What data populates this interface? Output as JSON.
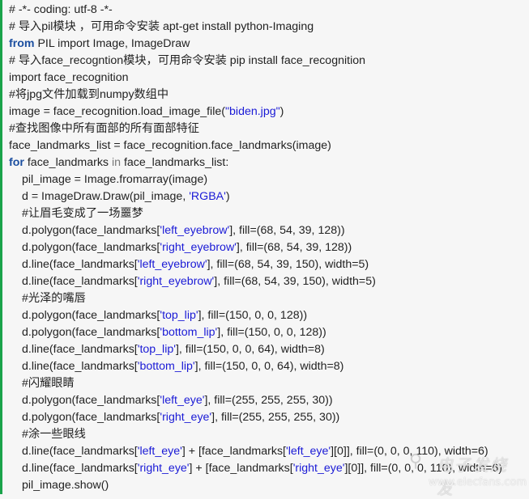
{
  "code": {
    "language": "python",
    "accent_border": "#1aa34a",
    "keyword_color": "#1c4fa0",
    "string_color": "#1a1ad6",
    "lines": [
      {
        "indent": 0,
        "parts": [
          {
            "t": "text",
            "v": "# -*- coding: utf-8 -*-"
          }
        ]
      },
      {
        "indent": 0,
        "parts": [
          {
            "t": "text",
            "v": "# 导入pil模块 ，可用命令安装 apt-get install python-Imaging"
          }
        ]
      },
      {
        "indent": 0,
        "parts": [
          {
            "t": "kw",
            "v": "from"
          },
          {
            "t": "text",
            "v": " PIL import Image, ImageDraw"
          }
        ]
      },
      {
        "indent": 0,
        "parts": [
          {
            "t": "text",
            "v": "# 导入face_recogntion模块，可用命令安装 pip install face_recognition"
          }
        ]
      },
      {
        "indent": 0,
        "parts": [
          {
            "t": "text",
            "v": "import face_recognition"
          }
        ]
      },
      {
        "indent": 0,
        "parts": [
          {
            "t": "text",
            "v": "#将jpg文件加载到numpy数组中"
          }
        ]
      },
      {
        "indent": 0,
        "parts": [
          {
            "t": "text",
            "v": "image = face_recognition.load_image_file("
          },
          {
            "t": "str",
            "v": "\"biden.jpg\""
          },
          {
            "t": "text",
            "v": ")"
          }
        ]
      },
      {
        "indent": 0,
        "parts": [
          {
            "t": "text",
            "v": "#查找图像中所有面部的所有面部特征"
          }
        ]
      },
      {
        "indent": 0,
        "parts": [
          {
            "t": "text",
            "v": "face_landmarks_list = face_recognition.face_landmarks(image)"
          }
        ]
      },
      {
        "indent": 0,
        "parts": [
          {
            "t": "kw",
            "v": "for"
          },
          {
            "t": "text",
            "v": " face_landmarks "
          },
          {
            "t": "kwin",
            "v": "in"
          },
          {
            "t": "text",
            "v": " face_landmarks_list:"
          }
        ]
      },
      {
        "indent": 1,
        "parts": [
          {
            "t": "text",
            "v": "pil_image = Image.fromarray(image)"
          }
        ]
      },
      {
        "indent": 1,
        "parts": [
          {
            "t": "text",
            "v": "d = ImageDraw.Draw(pil_image, "
          },
          {
            "t": "str",
            "v": "'RGBA'"
          },
          {
            "t": "text",
            "v": ")"
          }
        ]
      },
      {
        "indent": 1,
        "parts": [
          {
            "t": "text",
            "v": "#让眉毛变成了一场噩梦"
          }
        ]
      },
      {
        "indent": 1,
        "parts": [
          {
            "t": "text",
            "v": "d.polygon(face_landmarks["
          },
          {
            "t": "str",
            "v": "'left_eyebrow'"
          },
          {
            "t": "text",
            "v": "], fill=(68, 54, 39, 128))"
          }
        ]
      },
      {
        "indent": 1,
        "parts": [
          {
            "t": "text",
            "v": "d.polygon(face_landmarks["
          },
          {
            "t": "str",
            "v": "'right_eyebrow'"
          },
          {
            "t": "text",
            "v": "], fill=(68, 54, 39, 128))"
          }
        ]
      },
      {
        "indent": 1,
        "parts": [
          {
            "t": "text",
            "v": "d.line(face_landmarks["
          },
          {
            "t": "str",
            "v": "'left_eyebrow'"
          },
          {
            "t": "text",
            "v": "], fill=(68, 54, 39, 150), width=5)"
          }
        ]
      },
      {
        "indent": 1,
        "parts": [
          {
            "t": "text",
            "v": "d.line(face_landmarks["
          },
          {
            "t": "str",
            "v": "'right_eyebrow'"
          },
          {
            "t": "text",
            "v": "], fill=(68, 54, 39, 150), width=5)"
          }
        ]
      },
      {
        "indent": 1,
        "parts": [
          {
            "t": "text",
            "v": "#光泽的嘴唇"
          }
        ]
      },
      {
        "indent": 1,
        "parts": [
          {
            "t": "text",
            "v": "d.polygon(face_landmarks["
          },
          {
            "t": "str",
            "v": "'top_lip'"
          },
          {
            "t": "text",
            "v": "], fill=(150, 0, 0, 128))"
          }
        ]
      },
      {
        "indent": 1,
        "parts": [
          {
            "t": "text",
            "v": "d.polygon(face_landmarks["
          },
          {
            "t": "str",
            "v": "'bottom_lip'"
          },
          {
            "t": "text",
            "v": "], fill=(150, 0, 0, 128))"
          }
        ]
      },
      {
        "indent": 1,
        "parts": [
          {
            "t": "text",
            "v": "d.line(face_landmarks["
          },
          {
            "t": "str",
            "v": "'top_lip'"
          },
          {
            "t": "text",
            "v": "], fill=(150, 0, 0, 64), width=8)"
          }
        ]
      },
      {
        "indent": 1,
        "parts": [
          {
            "t": "text",
            "v": "d.line(face_landmarks["
          },
          {
            "t": "str",
            "v": "'bottom_lip'"
          },
          {
            "t": "text",
            "v": "], fill=(150, 0, 0, 64), width=8)"
          }
        ]
      },
      {
        "indent": 1,
        "parts": [
          {
            "t": "text",
            "v": "#闪耀眼睛"
          }
        ]
      },
      {
        "indent": 1,
        "parts": [
          {
            "t": "text",
            "v": "d.polygon(face_landmarks["
          },
          {
            "t": "str",
            "v": "'left_eye'"
          },
          {
            "t": "text",
            "v": "], fill=(255, 255, 255, 30))"
          }
        ]
      },
      {
        "indent": 1,
        "parts": [
          {
            "t": "text",
            "v": "d.polygon(face_landmarks["
          },
          {
            "t": "str",
            "v": "'right_eye'"
          },
          {
            "t": "text",
            "v": "], fill=(255, 255, 255, 30))"
          }
        ]
      },
      {
        "indent": 1,
        "parts": [
          {
            "t": "text",
            "v": "#涂一些眼线"
          }
        ]
      },
      {
        "indent": 1,
        "parts": [
          {
            "t": "text",
            "v": "d.line(face_landmarks["
          },
          {
            "t": "str",
            "v": "'left_eye'"
          },
          {
            "t": "text",
            "v": "] + [face_landmarks["
          },
          {
            "t": "str",
            "v": "'left_eye'"
          },
          {
            "t": "text",
            "v": "][0]], fill=(0, 0, 0, 110), width=6)"
          }
        ]
      },
      {
        "indent": 1,
        "parts": [
          {
            "t": "text",
            "v": "d.line(face_landmarks["
          },
          {
            "t": "str",
            "v": "'right_eye'"
          },
          {
            "t": "text",
            "v": "] + [face_landmarks["
          },
          {
            "t": "str",
            "v": "'right_eye'"
          },
          {
            "t": "text",
            "v": "][0]], fill=(0, 0, 0, 110), width=6)"
          }
        ]
      },
      {
        "indent": 1,
        "parts": [
          {
            "t": "text",
            "v": "pil_image.show()"
          }
        ]
      }
    ]
  },
  "watermark": {
    "logo_icon": "circuit-logo-icon",
    "name": "电子发烧友",
    "url": "www.elecfans.com"
  }
}
